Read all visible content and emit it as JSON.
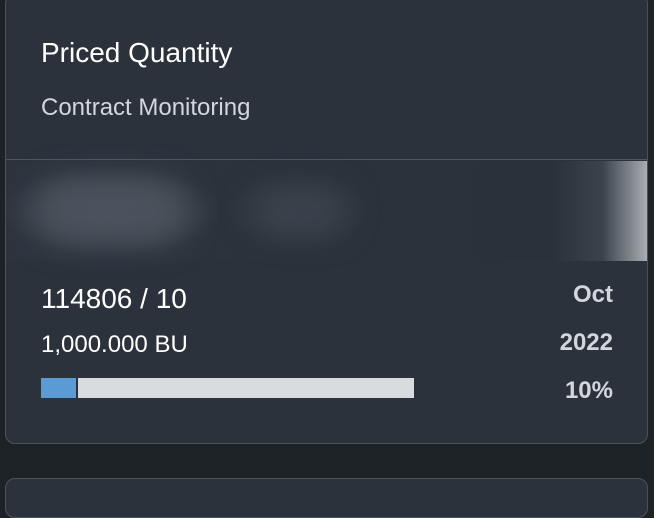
{
  "card": {
    "title": "Priced Quantity",
    "subtitle": "Contract Monitoring"
  },
  "details": {
    "contract_id": "114806 / 10",
    "quantity": "1,000.000 BU",
    "month": "Oct",
    "year": "2022",
    "percent_label": "10%",
    "progress_fraction": 0.1
  },
  "colors": {
    "card_background": "#2b323c",
    "page_background": "#1d2227",
    "progress_fill": "#5b9bd5",
    "progress_track": "#d9dcdf"
  }
}
